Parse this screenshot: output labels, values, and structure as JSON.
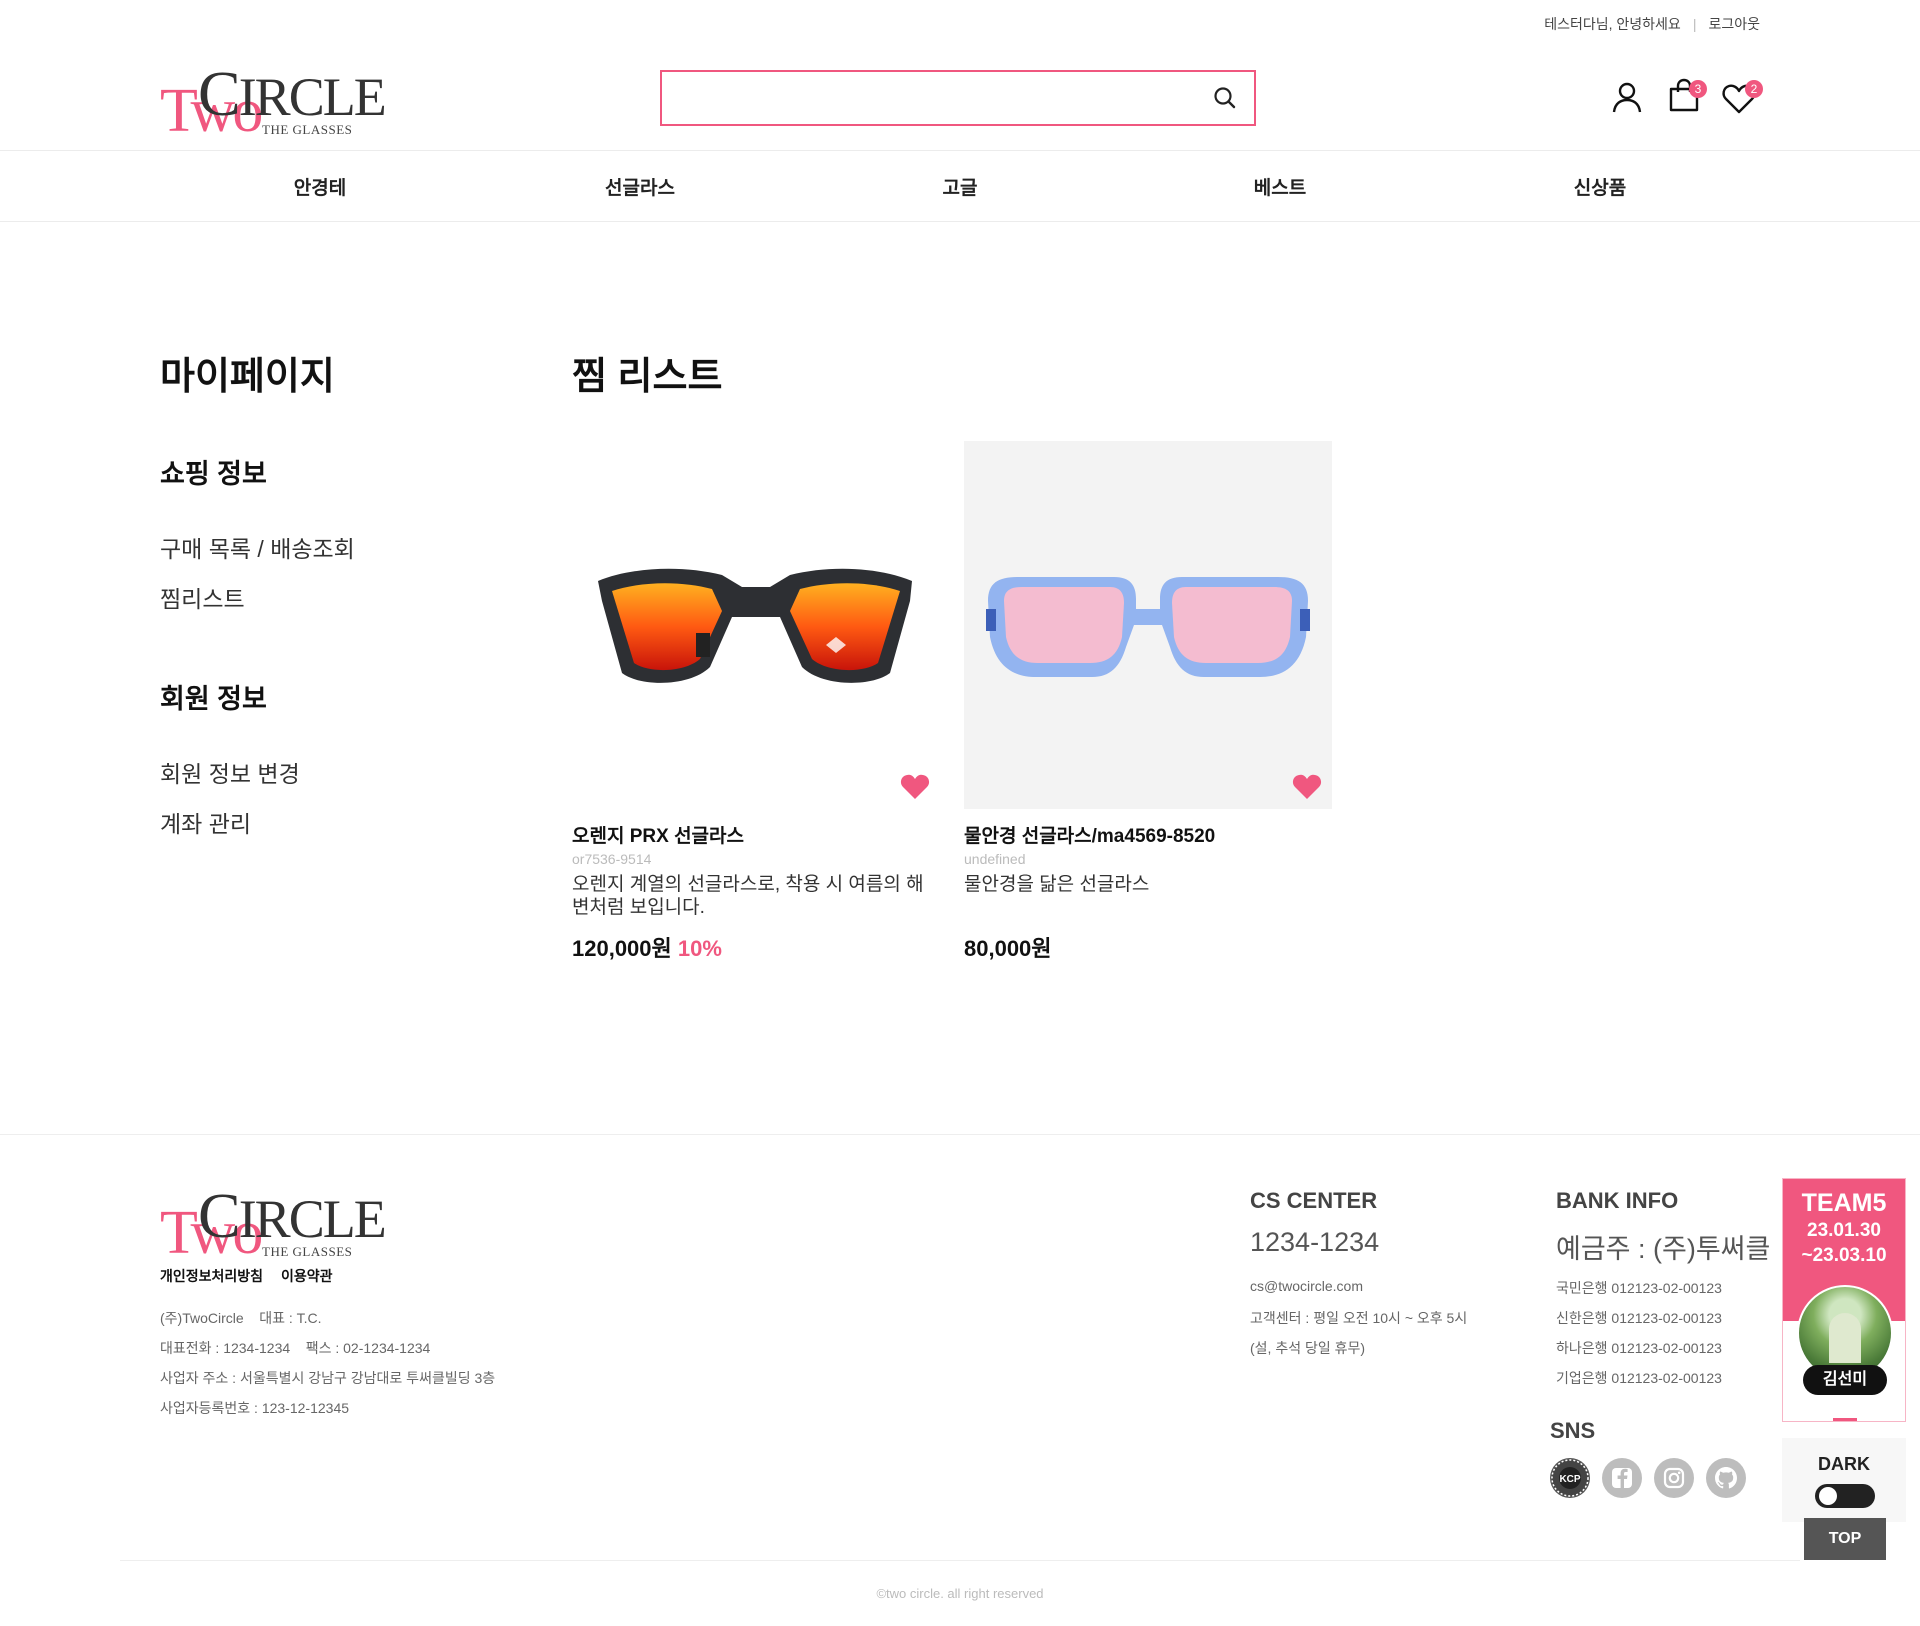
{
  "header": {
    "greeting": "테스터다님, 안녕하세요",
    "logout": "로그아웃",
    "logo": {
      "two": "Two",
      "circle_c": "C",
      "circle_rest": "IRCLE",
      "subtitle": "THE GLASSES"
    },
    "search": {
      "value": "",
      "placeholder": ""
    },
    "cart_count": "3",
    "wish_count": "2"
  },
  "nav": [
    "안경테",
    "선글라스",
    "고글",
    "베스트",
    "신상품"
  ],
  "sidebar": {
    "title": "마이페이지",
    "shopping_heading": "쇼핑 정보",
    "shopping_links": [
      "구매 목록 / 배송조회",
      "찜리스트"
    ],
    "member_heading": "회원 정보",
    "member_links": [
      "회원 정보 변경",
      "계좌 관리"
    ]
  },
  "main": {
    "title": "찜 리스트",
    "items": [
      {
        "name": "오렌지 PRX 선글라스",
        "code": "or7536-9514",
        "desc": "오렌지 계열의 선글라스로, 착용 시 여름의 해변처럼 보입니다.",
        "price": "120,000원",
        "discount": "10%"
      },
      {
        "name": "물안경 선글라스/ma4569-8520",
        "code": "undefined",
        "desc": "물안경을 닮은 선글라스",
        "price": "80,000원",
        "discount": ""
      }
    ]
  },
  "footer": {
    "links": [
      "개인정보처리방침",
      "이용약관"
    ],
    "company": "(주)TwoCircle",
    "ceo": "대표 : T.C.",
    "phone": "대표전화 : 1234-1234",
    "fax": "팩스 : 02-1234-1234",
    "address": "사업자 주소 : 서울특별시 강남구 강남대로 투써클빌딩 3층",
    "biz_no": "사업자등록번호 : 123-12-12345",
    "cs": {
      "heading": "CS CENTER",
      "phone": "1234-1234",
      "email": "cs@twocircle.com",
      "hours": "고객센터 : 평일 오전 10시 ~ 오후 5시",
      "holiday": "(설, 추석 당일 휴무)"
    },
    "bank": {
      "heading": "BANK INFO",
      "holder": "예금주 : (주)투써클",
      "accounts": [
        "국민은행 012123-02-00123",
        "신한은행 012123-02-00123",
        "하나은행 012123-02-00123",
        "기업은행 012123-02-00123"
      ]
    },
    "sns_heading": "SNS",
    "sns_icons": [
      "kcp-icon",
      "facebook-icon",
      "instagram-icon",
      "github-icon"
    ],
    "kcp_label": "KCP",
    "copyright": "©two circle. all right reserved"
  },
  "widget": {
    "team": "TEAM5",
    "date_from": "23.01.30",
    "date_to": "~23.03.10",
    "member_name": "김선미",
    "dark_label": "DARK",
    "top_label": "TOP"
  },
  "colors": {
    "accent": "#f0577f",
    "text": "#222222",
    "muted": "#bbbbbb"
  }
}
